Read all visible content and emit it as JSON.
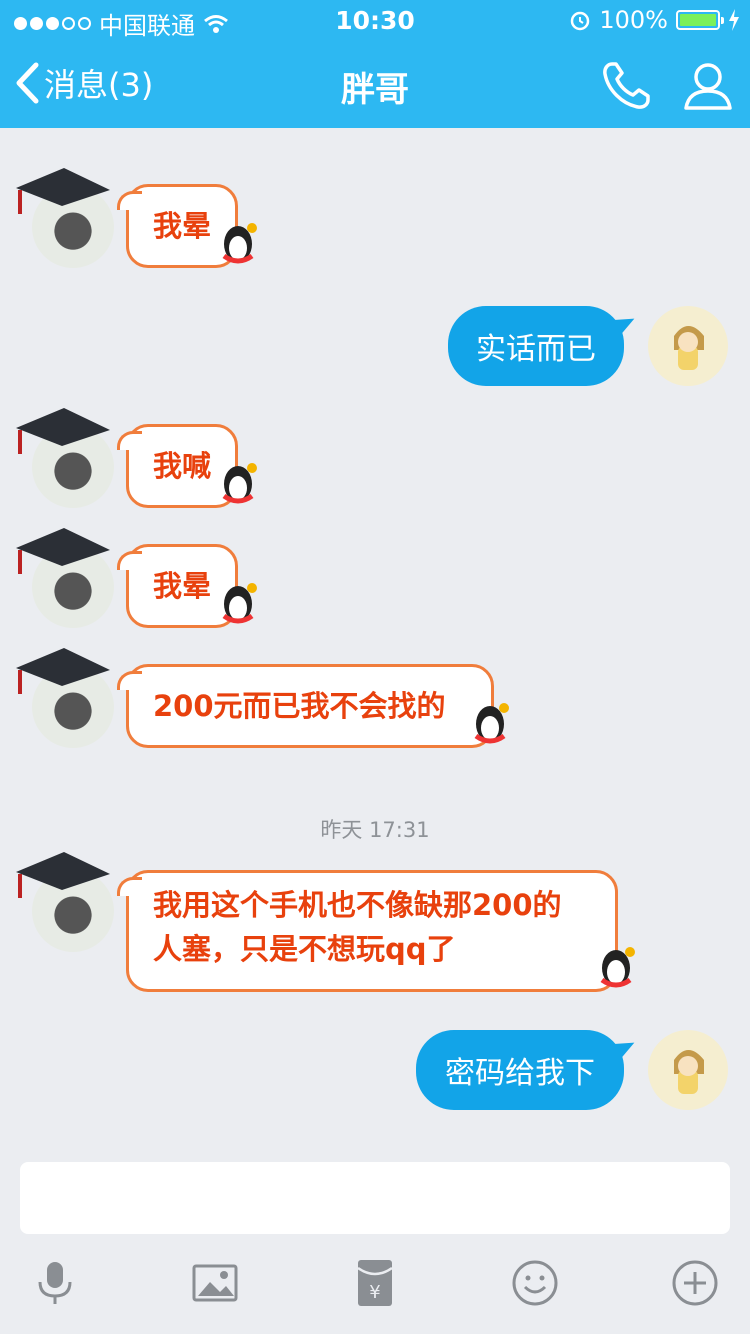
{
  "status_bar": {
    "carrier": "中国联通",
    "time": "10:30",
    "battery": "100%"
  },
  "nav": {
    "back_label": "消息(3)",
    "title": "胖哥"
  },
  "messages": [
    {
      "side": "left",
      "text": "我晕"
    },
    {
      "side": "right",
      "text": "实话而已"
    },
    {
      "side": "left",
      "text": "我喊"
    },
    {
      "side": "left",
      "text": "我晕"
    },
    {
      "side": "left",
      "text": "200元而已我不会找的"
    },
    {
      "side": "left",
      "text": "我用这个手机也不像缺那200的人塞，只是不想玩qq了"
    },
    {
      "side": "right",
      "text": "密码给我下"
    }
  ],
  "timestamp": "昨天 17:31",
  "icons": {
    "back": "chevron-left-icon",
    "call": "phone-icon",
    "profile": "person-icon",
    "toolbar": [
      "microphone-icon",
      "image-icon",
      "red-packet-icon",
      "emoji-icon",
      "plus-icon"
    ]
  },
  "colors": {
    "header": "#2db8f2",
    "background": "#ebedf1",
    "outgoing_bubble": "#12a4e8",
    "incoming_text": "#e8410d",
    "incoming_border": "#f07d3c"
  }
}
